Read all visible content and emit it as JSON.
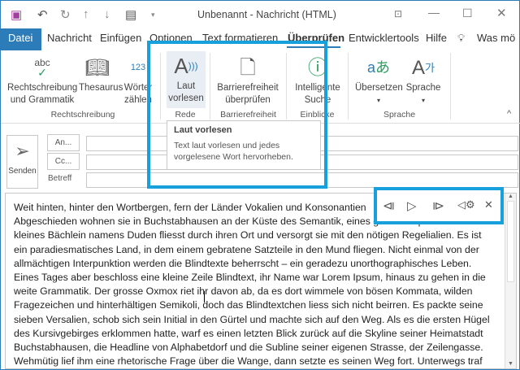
{
  "window": {
    "title": "Unbenannt  -  Nachricht (HTML)"
  },
  "tabs": [
    {
      "label": "Datei"
    },
    {
      "label": "Nachricht"
    },
    {
      "label": "Einfügen"
    },
    {
      "label": "Optionen"
    },
    {
      "label": "Text formatieren"
    },
    {
      "label": "Überprüfen"
    },
    {
      "label": "Entwicklertools"
    },
    {
      "label": "Hilfe"
    },
    {
      "label": "Was mö"
    }
  ],
  "ribbon": {
    "spelling": {
      "line1": "Rechtschreibung",
      "line2": "und Grammatik",
      "icon_text": "abc"
    },
    "thesaurus": {
      "label": "Thesaurus"
    },
    "wordcount": {
      "line1": "Wörter",
      "line2": "zählen",
      "icon_text": "123"
    },
    "read_aloud": {
      "line1": "Laut",
      "line2": "vorlesen"
    },
    "accessibility": {
      "line1": "Barrierefreiheit",
      "line2": "überprüfen"
    },
    "smart_lookup": {
      "line1": "Intelligente",
      "line2": "Suche"
    },
    "translate": {
      "label": "Übersetzen"
    },
    "language": {
      "label": "Sprache"
    },
    "groups": [
      "Rechtschreibung",
      "Rede",
      "Barrierefreiheit",
      "Einblicke",
      "Sprache"
    ]
  },
  "tooltip": {
    "title": "Laut vorlesen",
    "line1": "Text laut vorlesen und jedes",
    "line2": "vorgelesene Wort hervorheben."
  },
  "compose": {
    "send": "Senden",
    "to": "An...",
    "cc": "Cc...",
    "subject": "Betreff"
  },
  "body_lines": [
    "Weit hinten, hinter den Wortbergen, fern der Länder Vokalien und Konsonantien",
    "Abgeschieden wohnen sie in Buchstabhausen an der Küste des Semantik, eines grossen Sprachozeans. Ein",
    "kleines Bächlein namens Duden fliesst durch ihren Ort und versorgt sie mit den nötigen Regelialien. Es ist",
    "ein paradiesmatisches Land, in dem einem gebratene Satzteile in den Mund fliegen. Nicht einmal von der",
    "allmächtigen Interpunktion werden die Blindtexte beherrscht – ein geradezu unorthographisches Leben.",
    "Eines Tages aber beschloss eine kleine Zeile Blindtext, ihr Name war Lorem Ipsum, hinaus zu gehen in die",
    "weite Grammatik. Der grosse Oxmox riet ihr davon ab, da es dort wimmele von bösen Kommata, wilden",
    "Fragezeichen und hinterhältigen Semikoli, doch das Blindtextchen liess sich nicht beirren. Es packte seine",
    "sieben Versalien, schob sich sein Initial in den Gürtel und machte sich auf den Weg. Als es die ersten Hügel",
    "des Kursivgebirges erklommen hatte, warf es einen letzten Blick zurück auf die Skyline seiner Heimatstadt",
    "Buchstabhausen, die Headline von Alphabetdorf und die Subline seiner eigenen Strasse, der Zeilengasse.",
    "Wehmütig lief ihm eine rhetorische Frage über die Wange, dann setzte es seinen Weg fort. Unterwegs traf"
  ],
  "colors": {
    "accent": "#2b7cb8",
    "highlight": "#17a0dc"
  }
}
